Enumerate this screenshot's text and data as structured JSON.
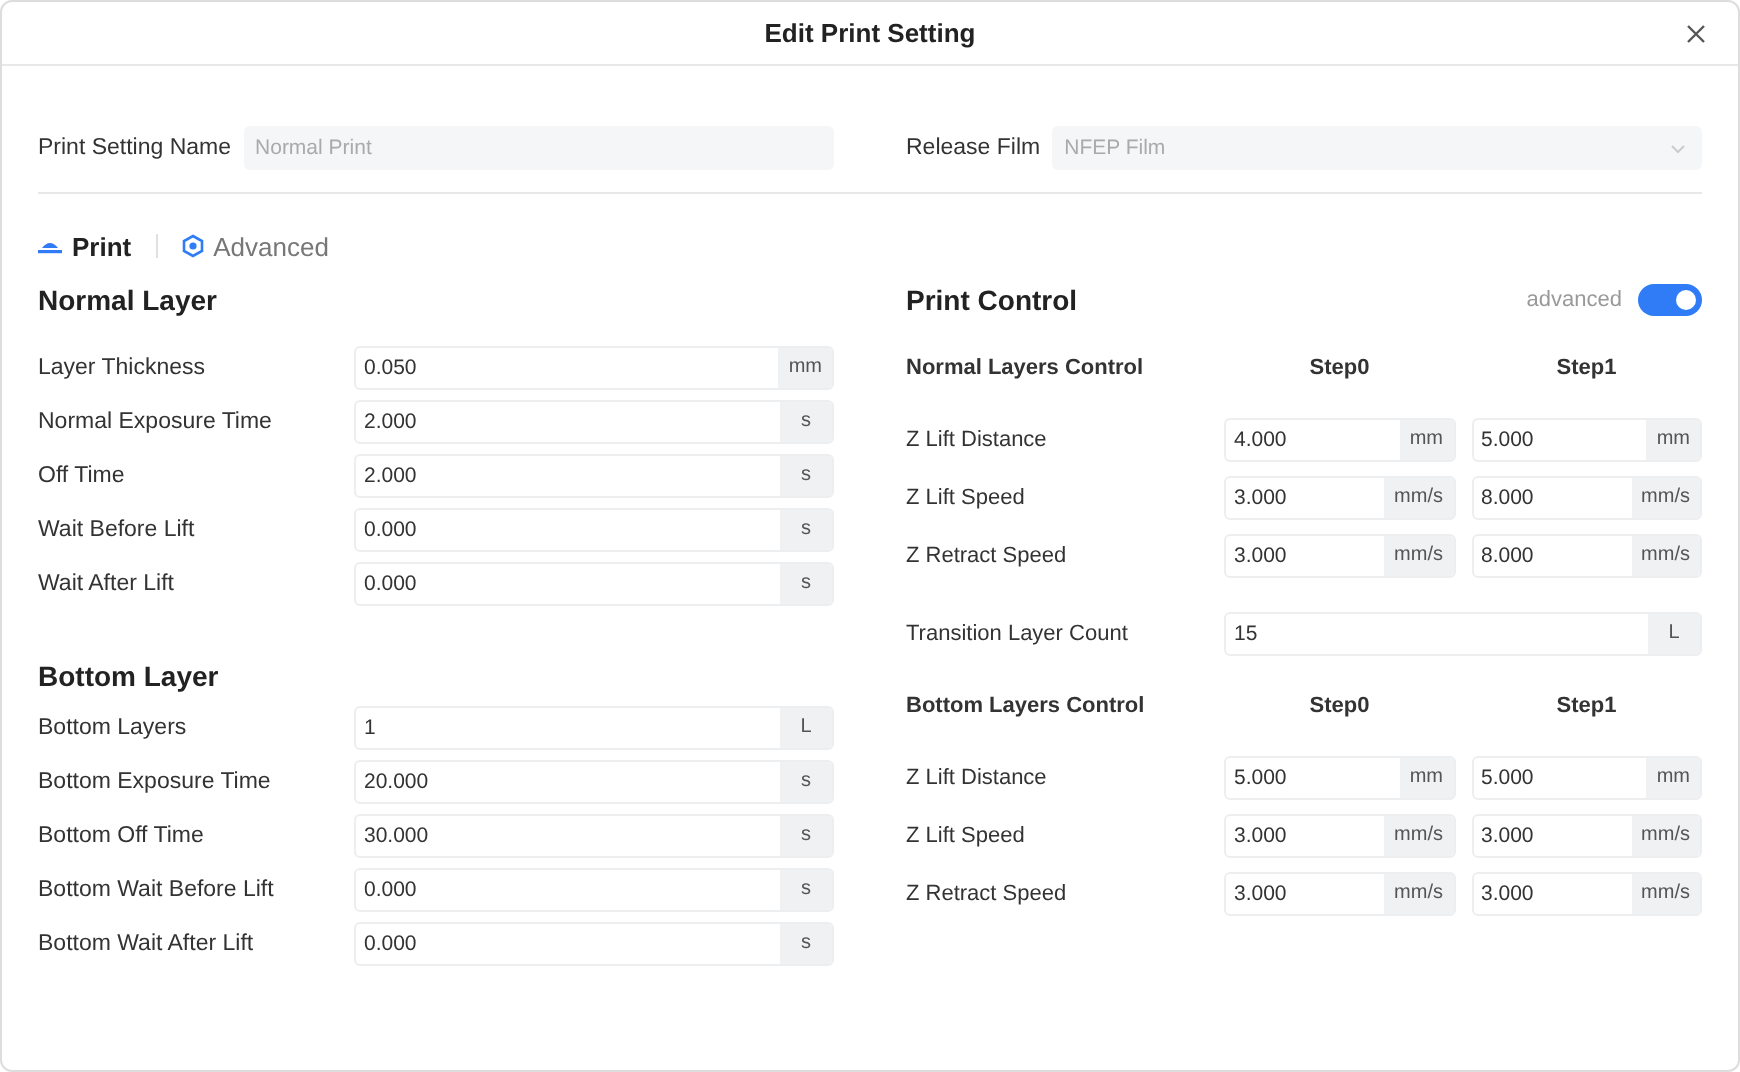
{
  "dialog": {
    "title": "Edit Print Setting"
  },
  "print_setting_name": {
    "label": "Print Setting Name",
    "value": "Normal Print",
    "disabled": true
  },
  "release_film": {
    "label": "Release Film",
    "value": "NFEP Film",
    "disabled": true
  },
  "tabs": [
    {
      "label": "Print",
      "selected": true
    },
    {
      "label": "Advanced",
      "selected": false
    }
  ],
  "sections": [
    {
      "title": "Normal Layer",
      "fields": [
        {
          "label": "Layer Thickness",
          "value": "0.050",
          "unit": "mm"
        },
        {
          "label": "Normal Exposure Time",
          "value": "2.000",
          "unit": "s"
        },
        {
          "label": "Off Time",
          "value": "2.000",
          "unit": "s"
        },
        {
          "label": "Wait Before Lift",
          "value": "0.000",
          "unit": "s"
        },
        {
          "label": "Wait After Lift",
          "value": "0.000",
          "unit": "s"
        }
      ]
    },
    {
      "title": "Bottom Layer",
      "fields": [
        {
          "label": "Bottom Layers",
          "value": "1",
          "unit": "L"
        },
        {
          "label": "Bottom Exposure Time",
          "value": "20.000",
          "unit": "s"
        },
        {
          "label": "Bottom Off Time",
          "value": "30.000",
          "unit": "s"
        },
        {
          "label": "Bottom Wait Before Lift",
          "value": "0.000",
          "unit": "s"
        },
        {
          "label": "Bottom Wait After Lift",
          "value": "0.000",
          "unit": "s"
        }
      ]
    }
  ],
  "print_control": {
    "title": "Print Control",
    "advanced_label": "advanced",
    "advanced_on": true,
    "items": [
      {
        "kind": "steps",
        "title": "Normal Layers Control",
        "columns": [
          "Step0",
          "Step1"
        ],
        "rows": [
          {
            "label": "Z Lift Distance",
            "cells": [
              {
                "value": "4.000",
                "unit": "mm"
              },
              {
                "value": "5.000",
                "unit": "mm"
              }
            ]
          },
          {
            "label": "Z Lift Speed",
            "cells": [
              {
                "value": "3.000",
                "unit": "mm/s"
              },
              {
                "value": "8.000",
                "unit": "mm/s"
              }
            ]
          },
          {
            "label": "Z Retract Speed",
            "cells": [
              {
                "value": "3.000",
                "unit": "mm/s"
              },
              {
                "value": "8.000",
                "unit": "mm/s"
              }
            ]
          }
        ]
      },
      {
        "kind": "field",
        "label": "Transition Layer Count",
        "value": "15",
        "unit": "L"
      },
      {
        "kind": "steps",
        "title": "Bottom Layers Control",
        "columns": [
          "Step0",
          "Step1"
        ],
        "rows": [
          {
            "label": "Z Lift Distance",
            "cells": [
              {
                "value": "5.000",
                "unit": "mm"
              },
              {
                "value": "5.000",
                "unit": "mm"
              }
            ]
          },
          {
            "label": "Z Lift Speed",
            "cells": [
              {
                "value": "3.000",
                "unit": "mm/s"
              },
              {
                "value": "3.000",
                "unit": "mm/s"
              }
            ]
          },
          {
            "label": "Z Retract Speed",
            "cells": [
              {
                "value": "3.000",
                "unit": "mm/s"
              },
              {
                "value": "3.000",
                "unit": "mm/s"
              }
            ]
          }
        ]
      }
    ]
  }
}
